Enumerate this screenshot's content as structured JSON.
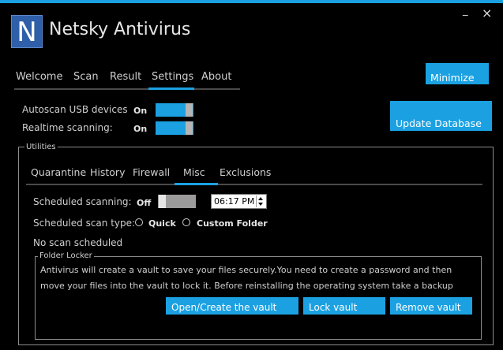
{
  "window": {
    "minimize_glyph": "_",
    "close_glyph": "×"
  },
  "app": {
    "logo_letter": "N",
    "title": "Netsky Antivirus"
  },
  "main_tabs": [
    "Welcome",
    "Scan",
    "Result",
    "Settings",
    "About"
  ],
  "active_main_tab": "Settings",
  "header": {
    "minimize_label": "Minimize",
    "update_label": "Update Database"
  },
  "settings": {
    "autoscan_label": "Autoscan USB devices",
    "autoscan_state": "On",
    "realtime_label": "Realtime scanning:",
    "realtime_state": "On"
  },
  "utilities": {
    "legend": "Utilities",
    "tabs": [
      "Quarantine",
      "History",
      "Firewall",
      "Misc",
      "Exclusions"
    ],
    "active_tab": "Misc"
  },
  "misc": {
    "scheduled_label": "Scheduled scanning:",
    "scheduled_state": "Off",
    "time_value": "06:17 PM",
    "scan_type_label": "Scheduled scan type:",
    "option_quick": "Quick",
    "option_custom": "Custom Folder",
    "status": "No scan scheduled"
  },
  "folder_locker": {
    "legend": "Folder Locker",
    "line1": "Antivirus will create a vault to save your files securely.You need to create a password and then",
    "line2": "move your files into the vault to lock it. Before reinstalling the operating system take a backup",
    "open_label": "Open/Create the vault",
    "lock_label": "Lock vault",
    "remove_label": "Remove vault"
  },
  "colors": {
    "accent": "#1ba1e2",
    "background": "#000000",
    "logo": "#2f5fa9"
  }
}
